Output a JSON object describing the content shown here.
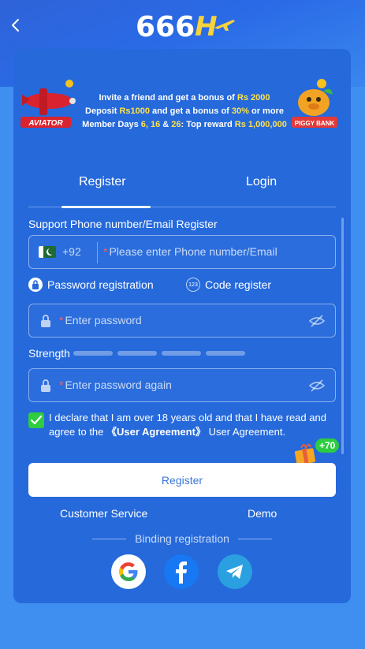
{
  "header": {
    "logo_text": "666",
    "logo_suffix": "H"
  },
  "banner": {
    "line1_pre": "Invite a friend and get a bonus of ",
    "line1_amount": "Rs 2000",
    "line2_pre": "Deposit ",
    "line2_amount": "Rs1000",
    "line2_mid": " and get a bonus of ",
    "line2_pct": "30%",
    "line2_post": " or more",
    "line3_pre": "Member Days ",
    "line3_days": "6, 16",
    "line3_and": " & ",
    "line3_day26": "26",
    "line3_mid": ": Top reward ",
    "line3_amount": "Rs 1,000,000",
    "aviator_label": "AVIATOR",
    "piggy_label": "PIGGY BANK"
  },
  "tabs": [
    {
      "label": "Register",
      "active": true
    },
    {
      "label": "Login",
      "active": false
    }
  ],
  "form": {
    "section_label": "Support Phone number/Email Register",
    "country_code": "+92",
    "phone_placeholder": "Please enter Phone number/Email",
    "mode_password": "Password registration",
    "mode_code": "Code register",
    "mode_code_icon_text": "123",
    "password_placeholder": "Enter password",
    "password_again_placeholder": "Enter password again",
    "strength_label": "Strength",
    "declare_text": "I declare that I am over 18 years old and that I have read and agree to the ",
    "agreement_link": "《User Agreement》",
    "declare_suffix": " User Agreement.",
    "bonus_badge": "+70",
    "register_button": "Register"
  },
  "links": {
    "customer_service": "Customer Service",
    "demo": "Demo"
  },
  "binding": {
    "label": "Binding registration",
    "providers": [
      "google",
      "facebook",
      "telegram"
    ]
  },
  "colors": {
    "page_bg": "#3f8ff0",
    "panel_bg": "#2569db",
    "highlight": "#ffe14a",
    "required": "#ff5d5d",
    "checkbox": "#2ecc40",
    "register_text": "#3a76d6"
  }
}
